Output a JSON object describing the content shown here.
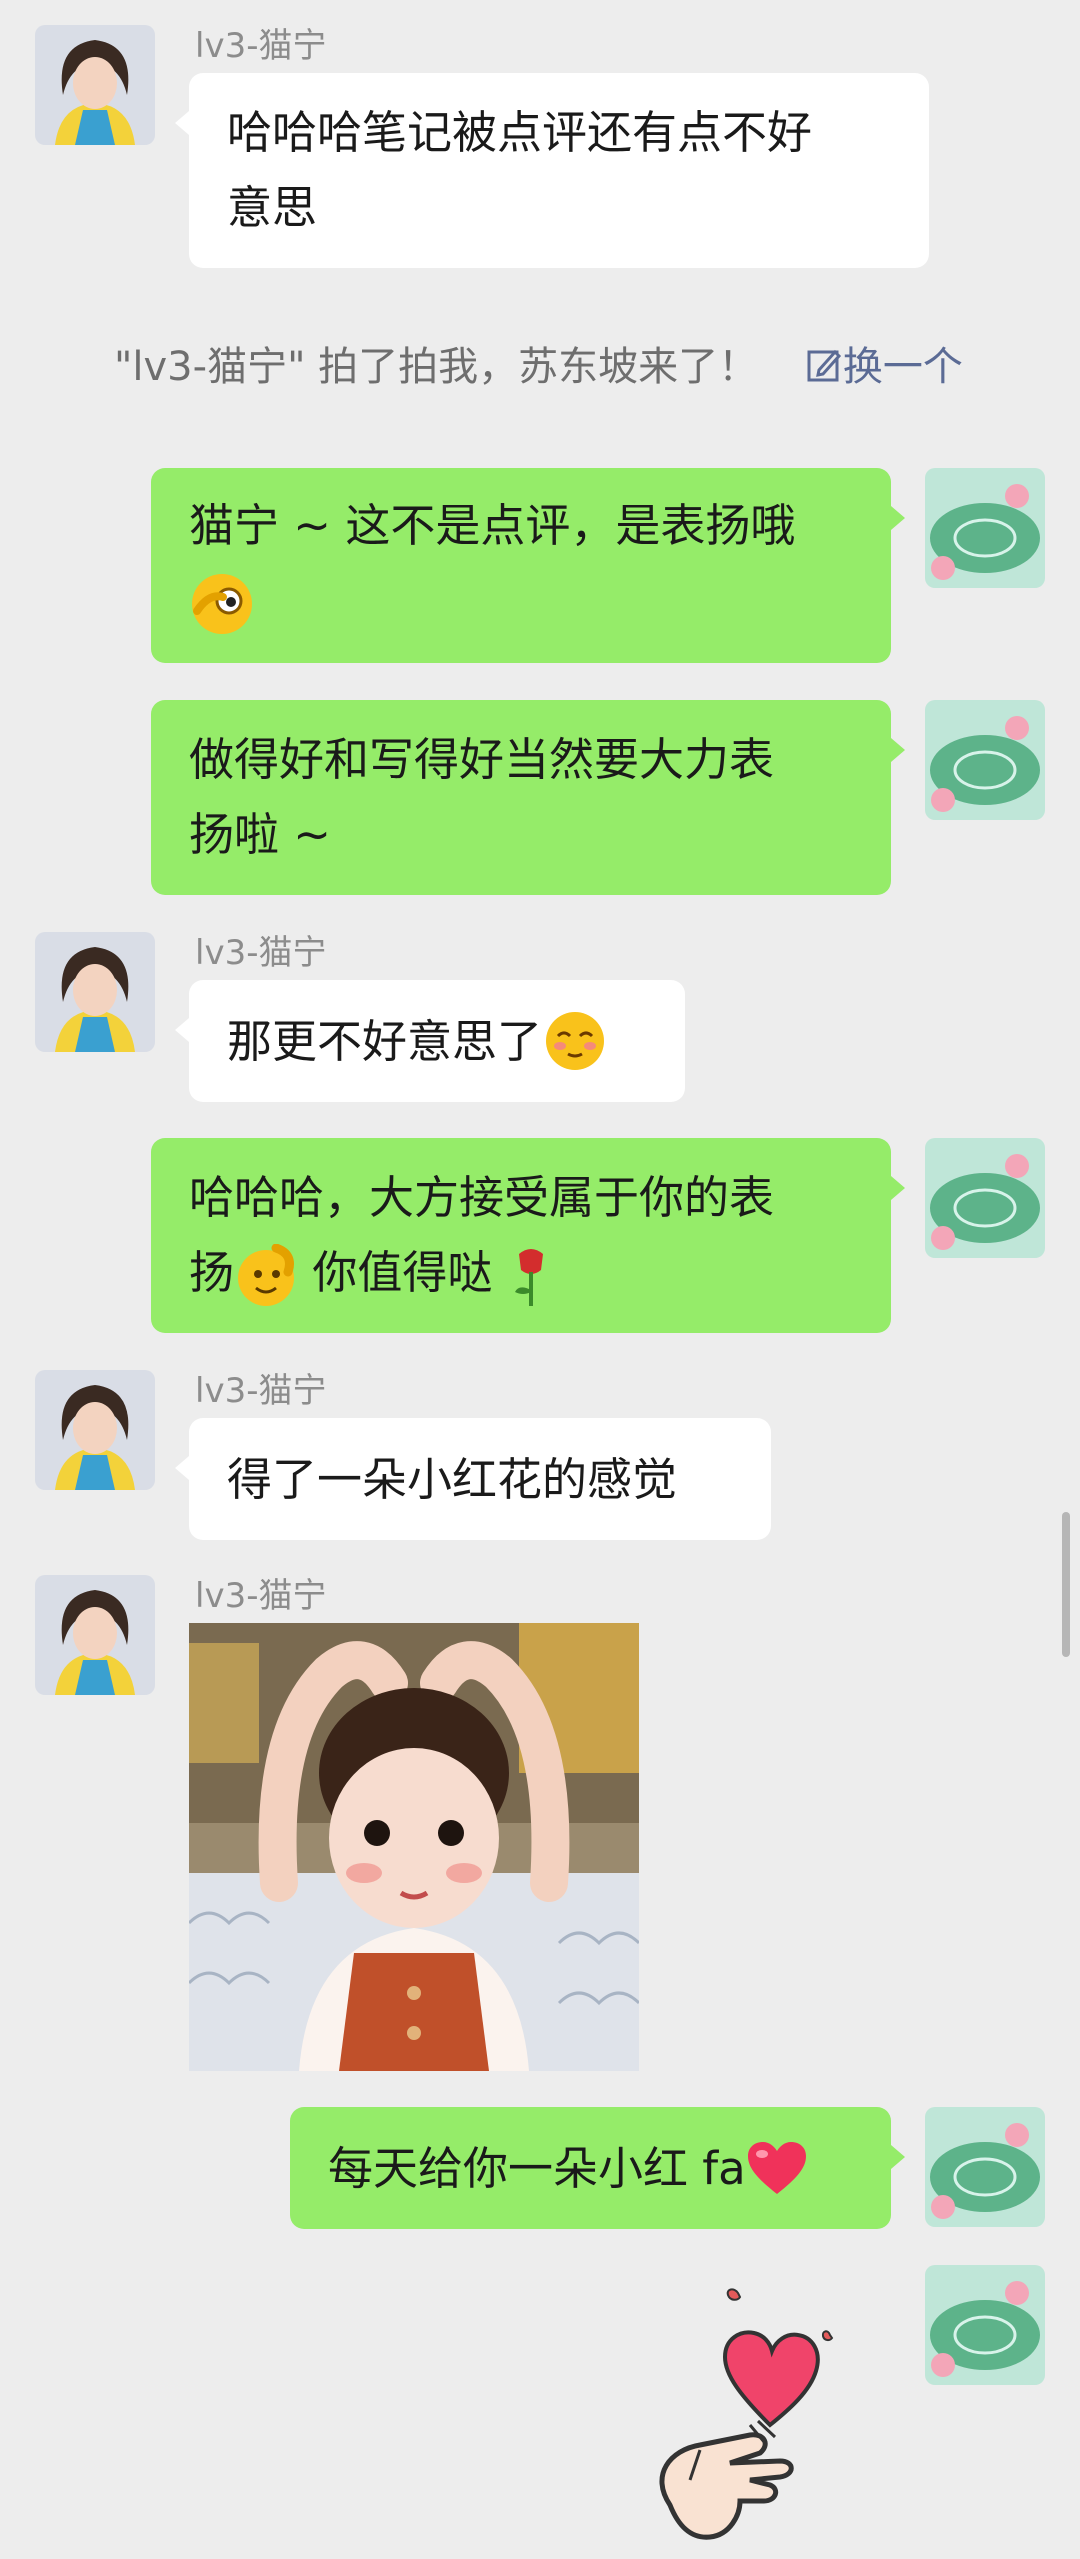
{
  "contact": {
    "name": "lv3-猫宁"
  },
  "system_notice": {
    "text": "\"lv3-猫宁\" 拍了拍我，苏东坡来了！",
    "action_label": "换一个"
  },
  "messages": [
    {
      "side": "in",
      "text_lines": [
        "哈哈哈笔记被点评还有点不好",
        "意思"
      ]
    },
    {
      "side": "out",
      "text": "猫宁 ~ 这不是点评，是表扬哦"
    },
    {
      "side": "out",
      "text_lines": [
        "做得好和写得好当然要大力表",
        "扬啦 ~"
      ]
    },
    {
      "side": "in",
      "text": "那更不好意思了"
    },
    {
      "side": "out",
      "line1": "哈哈哈，大方接受属于你的表",
      "line2_a": "扬",
      "line2_b": " 你值得哒"
    },
    {
      "side": "in",
      "text": "得了一朵小红花的感觉"
    },
    {
      "side": "in",
      "type": "image",
      "alt": "toddler-heart-photo"
    },
    {
      "side": "out",
      "text": "每天给你一朵小红 fa"
    },
    {
      "side": "out",
      "type": "sticker",
      "alt": "finger-heart-sticker"
    }
  ],
  "colors": {
    "background": "#ededed",
    "outgoing_bubble": "#95ec69",
    "incoming_bubble": "#ffffff",
    "link": "#5b6b95"
  }
}
